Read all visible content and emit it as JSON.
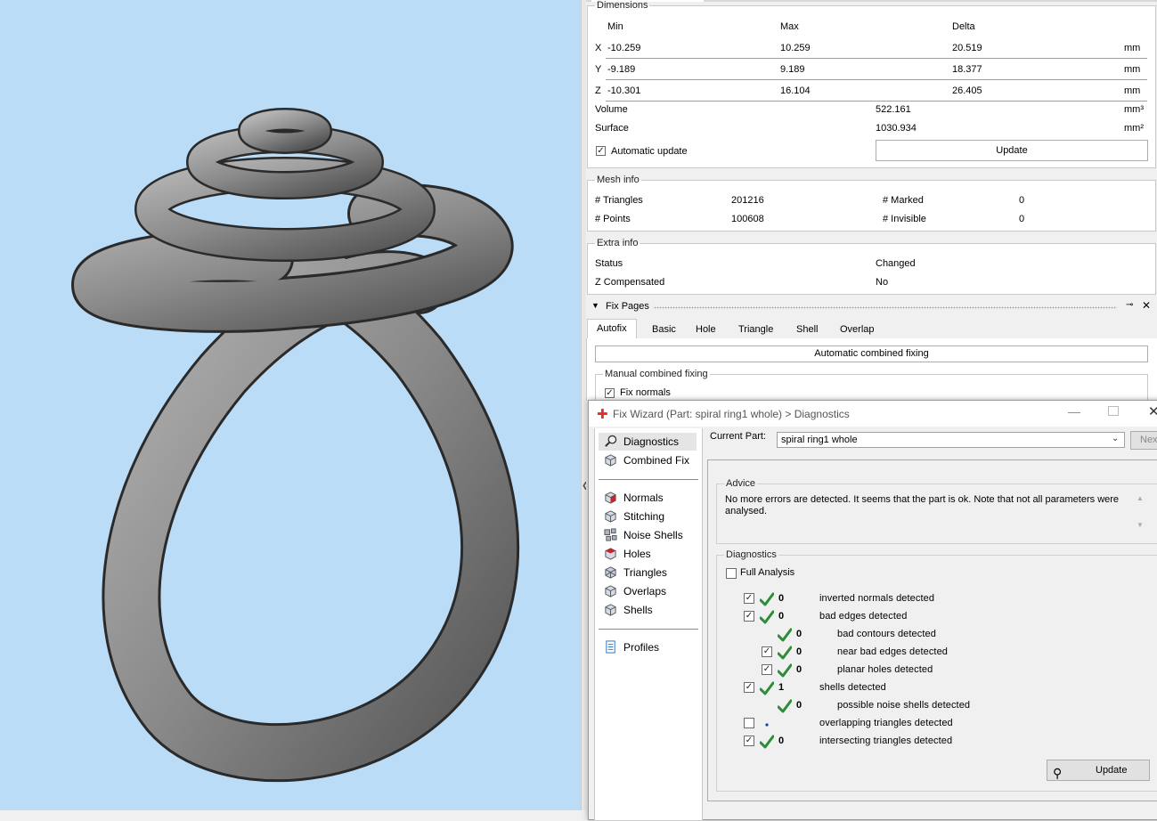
{
  "viewport": {
    "background_color": "#bbdcf7",
    "model_color": "#8c8c8c"
  },
  "dimensions": {
    "legend": "Dimensions",
    "headers": {
      "min": "Min",
      "max": "Max",
      "delta": "Delta"
    },
    "rows": [
      {
        "axis": "X",
        "min": "-10.259",
        "max": "10.259",
        "delta": "20.519",
        "unit": "mm"
      },
      {
        "axis": "Y",
        "min": "-9.189",
        "max": "9.189",
        "delta": "18.377",
        "unit": "mm"
      },
      {
        "axis": "Z",
        "min": "-10.301",
        "max": "16.104",
        "delta": "26.405",
        "unit": "mm"
      }
    ],
    "volume": {
      "label": "Volume",
      "value": "522.161",
      "unit": "mm³"
    },
    "surface": {
      "label": "Surface",
      "value": "1030.934",
      "unit": "mm²"
    },
    "auto_update_label": "Automatic update",
    "auto_update_checked": true,
    "update_button": "Update"
  },
  "mesh_info": {
    "legend": "Mesh info",
    "triangles_label": "# Triangles",
    "triangles_value": "201216",
    "points_label": "# Points",
    "points_value": "100608",
    "marked_label": "# Marked",
    "marked_value": "0",
    "invisible_label": "# Invisible",
    "invisible_value": "0"
  },
  "extra_info": {
    "legend": "Extra info",
    "status_label": "Status",
    "status_value": "Changed",
    "zcomp_label": "Z Compensated",
    "zcomp_value": "No"
  },
  "fix_pages": {
    "title": "Fix Pages",
    "tabs": [
      "Autofix",
      "Basic",
      "Hole",
      "Triangle",
      "Shell",
      "Overlap"
    ],
    "active_tab": "Autofix",
    "auto_combined_button": "Automatic combined fixing",
    "manual_legend": "Manual combined fixing",
    "fix_normals_label": "Fix normals"
  },
  "wizard": {
    "title": "Fix Wizard (Part: spiral ring1 whole) > Diagnostics",
    "nav_top": [
      "Diagnostics",
      "Combined Fix"
    ],
    "nav_fix": [
      "Normals",
      "Stitching",
      "Noise Shells",
      "Holes",
      "Triangles",
      "Overlaps",
      "Shells"
    ],
    "nav_bottom": [
      "Profiles"
    ],
    "current_part_label": "Current Part:",
    "current_part_value": "spiral ring1 whole",
    "next_button": "Nex",
    "advice_legend": "Advice",
    "advice_text": "No more errors are detected. It seems that the part is ok. Note that not all parameters were analysed.",
    "diagnostics_legend": "Diagnostics",
    "full_analysis_label": "Full Analysis",
    "items": [
      {
        "checkbox": true,
        "status": "ok",
        "count": "0",
        "label": "inverted normals detected",
        "indent": 0
      },
      {
        "checkbox": true,
        "status": "ok",
        "count": "0",
        "label": "bad edges detected",
        "indent": 0
      },
      {
        "checkbox": false,
        "status": "ok",
        "count": "0",
        "label": "bad contours detected",
        "indent": 1
      },
      {
        "checkbox": true,
        "status": "ok",
        "count": "0",
        "label": "near bad edges detected",
        "indent": 1
      },
      {
        "checkbox": true,
        "status": "ok",
        "count": "0",
        "label": "planar holes detected",
        "indent": 1
      },
      {
        "checkbox": true,
        "status": "ok",
        "count": "1",
        "label": "shells detected",
        "indent": 0
      },
      {
        "checkbox": false,
        "status": "ok",
        "count": "0",
        "label": "possible noise shells detected",
        "indent": 1
      },
      {
        "checkbox": true,
        "status": "pending",
        "count": "",
        "label": "overlapping triangles detected",
        "indent": 0
      },
      {
        "checkbox": true,
        "status": "ok",
        "count": "0",
        "label": "intersecting triangles detected",
        "indent": 0
      }
    ],
    "update_button": "Update",
    "check_color": "#2e8b3a"
  }
}
